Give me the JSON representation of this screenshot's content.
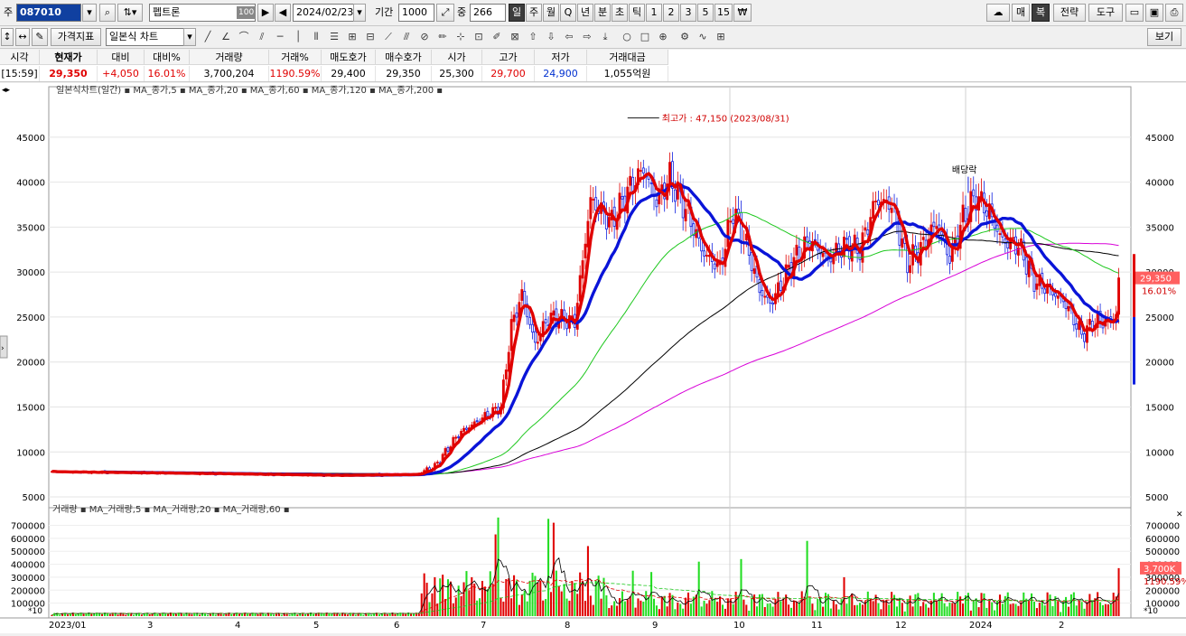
{
  "toolbar1": {
    "prefix": "주",
    "stock_code": "087010",
    "stock_name": "펩트론",
    "name_badge": "100",
    "date": "2024/02/23",
    "period_label": "기간",
    "period_value": "1000",
    "overlap_label": "중",
    "overlap_value": "266",
    "intervals": [
      "일",
      "주",
      "월",
      "Q",
      "년",
      "분",
      "초",
      "틱",
      "1",
      "2",
      "3",
      "5",
      "15"
    ],
    "right_buttons": [
      "매",
      "복",
      "전략",
      "도구"
    ]
  },
  "toolbar2": {
    "price_indicator_label": "가격지표",
    "chart_type_label": "일본식 차트",
    "view_button": "보기"
  },
  "quote": {
    "headers": [
      "시각",
      "현재가",
      "대비",
      "대비%",
      "거래량",
      "거래%",
      "매도호가",
      "매수호가",
      "시가",
      "고가",
      "저가",
      "거래대금"
    ],
    "values": [
      "[15:59]",
      "29,350",
      "+4,050",
      "16.01%",
      "3,700,204",
      "1190.59%",
      "29,400",
      "29,350",
      "25,300",
      "29,700",
      "24,900",
      "1,055억원"
    ]
  },
  "colors": {
    "ma5": "#e00000",
    "ma20": "#0a14d8",
    "ma60": "#1ec81e",
    "ma120": "#000000",
    "ma200": "#d800d8",
    "up": "#e00000",
    "down": "#1020e0",
    "vol_up": "#e00000",
    "vol_down": "#22dd22"
  },
  "chart_data": [
    {
      "type": "candlestick",
      "legend_text": "일본식차트(일간) ▪ MA_종가,5 ▪ MA_종가,20 ▪ MA_종가,60 ▪ MA_종가,120 ▪ MA_종가,200 ▪",
      "series_names": [
        "MA_종가,5",
        "MA_종가,20",
        "MA_종가,60",
        "MA_종가,120",
        "MA_종가,200"
      ],
      "x_labels": [
        "2023/01",
        "3",
        "4",
        "5",
        "6",
        "7",
        "8",
        "9",
        "10",
        "11",
        "12",
        "2024",
        "2"
      ],
      "y_ticks": [
        "45000",
        "40000",
        "35000",
        "30000",
        "25000",
        "20000",
        "15000",
        "10000",
        "5000"
      ],
      "ylim": [
        4000,
        49000
      ],
      "x_count": 280,
      "candles_note": "approximate daily OHLC reconstructed from figure",
      "anchor_path": [
        [
          0,
          7800
        ],
        [
          60,
          7600
        ],
        [
          108,
          7400
        ],
        [
          138,
          7500
        ],
        [
          145,
          8400
        ],
        [
          154,
          12000
        ],
        [
          163,
          13800
        ],
        [
          170,
          15000
        ],
        [
          174,
          24000
        ],
        [
          178,
          27500
        ],
        [
          183,
          22000
        ],
        [
          188,
          25000
        ],
        [
          198,
          24500
        ],
        [
          204,
          38000
        ],
        [
          212,
          35500
        ],
        [
          218,
          39000
        ],
        [
          224,
          41500
        ],
        [
          229,
          38000
        ],
        [
          234,
          40500
        ],
        [
          240,
          37000
        ],
        [
          247,
          32000
        ],
        [
          253,
          30500
        ],
        [
          258,
          37000
        ],
        [
          263,
          33000
        ],
        [
          268,
          28000
        ],
        [
          272,
          26500
        ],
        [
          276,
          28500
        ],
        [
          280,
          31000
        ],
        [
          287,
          33500
        ],
        [
          294,
          31500
        ],
        [
          300,
          33000
        ],
        [
          306,
          32500
        ],
        [
          312,
          38000
        ],
        [
          318,
          37500
        ],
        [
          324,
          31000
        ],
        [
          330,
          33000
        ],
        [
          335,
          35500
        ],
        [
          340,
          31500
        ],
        [
          345,
          36000
        ],
        [
          350,
          38500
        ],
        [
          355,
          36500
        ],
        [
          360,
          33500
        ],
        [
          366,
          33000
        ],
        [
          372,
          29000
        ],
        [
          378,
          28000
        ],
        [
          384,
          26500
        ],
        [
          390,
          23000
        ],
        [
          395,
          24500
        ],
        [
          400,
          24500
        ],
        [
          404,
          25000
        ]
      ],
      "annotations": [
        {
          "text": "최고가 : 47,150 (2023/08/31)",
          "x": 218,
          "y": 47150
        },
        {
          "text": "배당락",
          "x": 347,
          "y": 40000
        }
      ],
      "last_price_label": "29,350",
      "last_change_label": "16.01%"
    },
    {
      "type": "bar",
      "legend_text": "거래량 ▪ MA_거래량,5 ▪ MA_거래량,20 ▪ MA_거래량,60 ▪",
      "series_names": [
        "MA_거래량,5",
        "MA_거래량,20",
        "MA_거래량,60"
      ],
      "y_ticks": [
        "700000",
        "600000",
        "500000",
        "400000",
        "300000",
        "200000",
        "100000"
      ],
      "ylim": [
        0,
        780000
      ],
      "unit_label": "*10",
      "last_volume_label": "3,700K",
      "last_volume_pct_label": "1190.59%",
      "spikes": [
        [
          145,
          300000
        ],
        [
          159,
          300000
        ],
        [
          168,
          630000
        ],
        [
          169,
          760000
        ],
        [
          183,
          310000
        ],
        [
          188,
          750000
        ],
        [
          190,
          720000
        ],
        [
          203,
          540000
        ],
        [
          220,
          350000
        ],
        [
          227,
          340000
        ],
        [
          245,
          420000
        ],
        [
          261,
          440000
        ],
        [
          286,
          580000
        ],
        [
          300,
          300000
        ],
        [
          347,
          180000
        ],
        [
          404,
          370000
        ]
      ]
    }
  ]
}
